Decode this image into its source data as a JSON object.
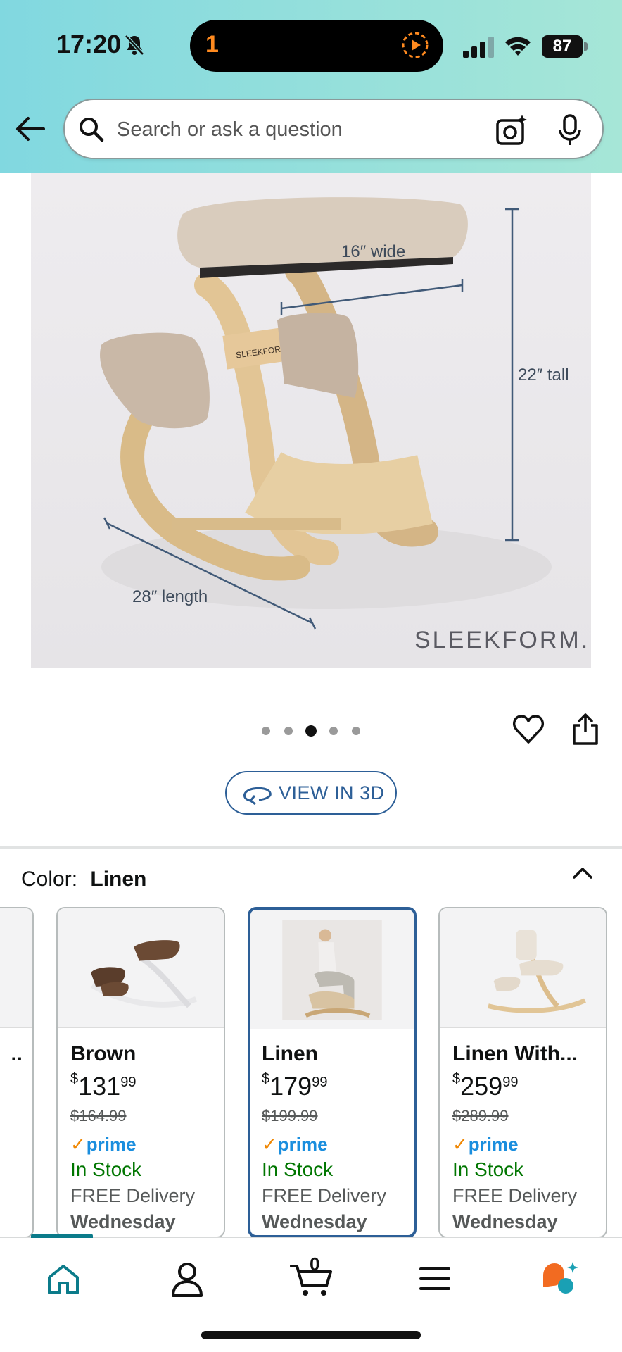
{
  "status_bar": {
    "time": "17:20",
    "island_counter": "1",
    "battery": "87"
  },
  "search": {
    "placeholder": "Search or ask a question"
  },
  "product_image": {
    "brand_watermark": "SLEEKFORM.",
    "bar_label": "SLEEKFORM.",
    "dim_wide": "16″ wide",
    "dim_tall": "22″ tall",
    "dim_length": "28″ length"
  },
  "carousel": {
    "total": 5,
    "active_index": 2
  },
  "view3d": {
    "label": "VIEW IN 3D"
  },
  "color_selector": {
    "label": "Color:",
    "selected": "Linen",
    "partial_card_name": "..",
    "variants": [
      {
        "name": "Brown",
        "price_dollars": "131",
        "price_cents": "99",
        "list_price": "$164.99",
        "prime": "prime",
        "stock": "In Stock",
        "delivery": "FREE Delivery",
        "day": "Wednesday",
        "selected": false
      },
      {
        "name": "Linen",
        "price_dollars": "179",
        "price_cents": "99",
        "list_price": "$199.99",
        "prime": "prime",
        "stock": "In Stock",
        "delivery": "FREE Delivery",
        "day": "Wednesday",
        "selected": true
      },
      {
        "name": "Linen With...",
        "price_dollars": "259",
        "price_cents": "99",
        "list_price": "$289.99",
        "prime": "prime",
        "stock": "In Stock",
        "delivery": "FREE Delivery",
        "day": "Wednesday",
        "selected": false
      }
    ]
  },
  "bottom_nav": {
    "cart_count": "0"
  },
  "colors": {
    "accent_blue": "#2d5f97",
    "prime_blue": "#1a8ede",
    "in_stock_green": "#007600",
    "nav_teal": "#0b7b8a",
    "header_gradient_left": "#81d8e0",
    "header_gradient_right": "#a6e6d7"
  }
}
